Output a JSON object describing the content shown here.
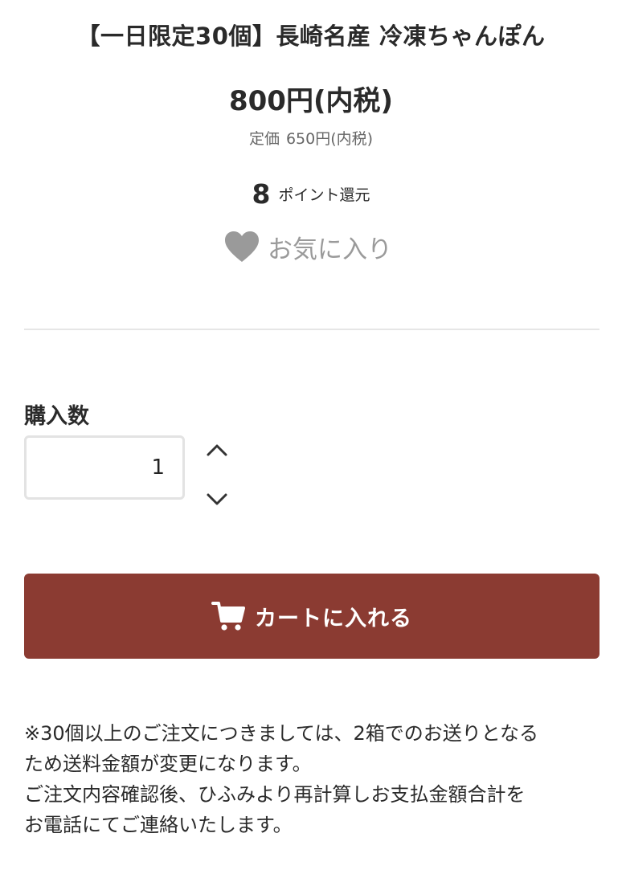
{
  "product": {
    "title": "【一日限定30個】長崎名産 冷凍ちゃんぽん",
    "price": "800円(内税)",
    "list_price_label": "定価",
    "list_price_value": "650円(内税)",
    "points_value": "8",
    "points_label": "ポイント還元"
  },
  "favorite": {
    "label": "お気に入り",
    "icon": "heart-icon"
  },
  "quantity": {
    "label": "購入数",
    "value": "1",
    "increment_icon": "chevron-up-icon",
    "decrement_icon": "chevron-down-icon"
  },
  "cart_button": {
    "label": "カートに入れる",
    "icon": "cart-icon",
    "color": "#8b3b32"
  },
  "notice": {
    "lines": [
      "※30個以上のご注文につきましては、2箱でのお送りとなる",
      "ため送料金額が変更になります。",
      "ご注文内容確認後、ひふみより再計算しお支払金額合計を",
      "お電話にてご連絡いたします。"
    ]
  }
}
